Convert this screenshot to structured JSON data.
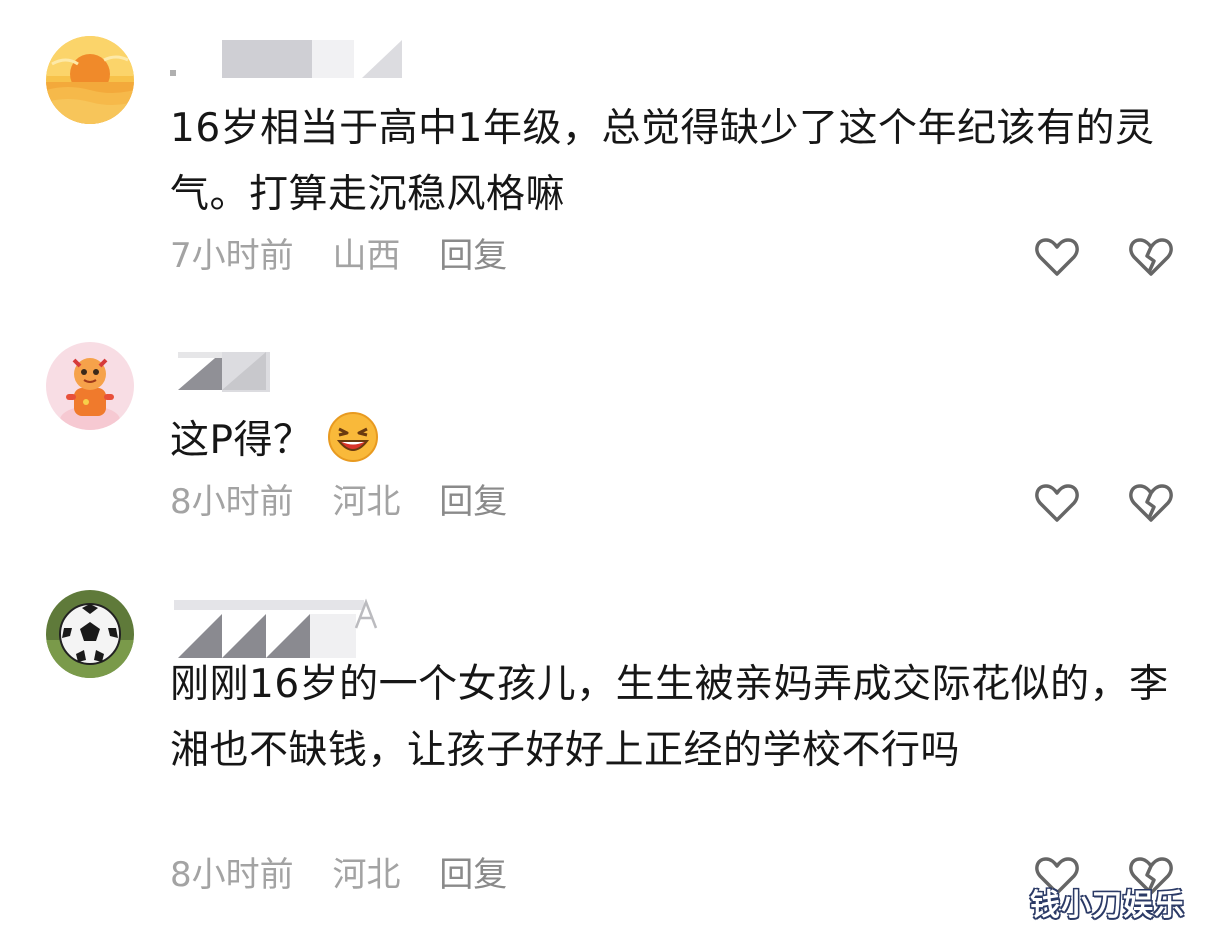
{
  "comments": [
    {
      "text": "16岁相当于高中1年级，总觉得缺少了这个年纪该有的灵气。打算走沉稳风格嘛",
      "time": "7小时前",
      "location": "山西",
      "reply_label": "回复",
      "avatar_icon": "sunset-avatar-icon"
    },
    {
      "text": "这P得？",
      "emoji_icon": "laughing-emoji-icon",
      "time": "8小时前",
      "location": "河北",
      "reply_label": "回复",
      "avatar_icon": "cartoon-character-avatar-icon"
    },
    {
      "text": "刚刚16岁的一个女孩儿，生生被亲妈弄成交际花似的，李湘也不缺钱，让孩子好好上正经的学校不行吗",
      "time": "8小时前",
      "location": "河北",
      "reply_label": "回复",
      "avatar_icon": "soccer-ball-avatar-icon"
    }
  ],
  "watermark": "钱小刀娱乐",
  "colors": {
    "text": "#161616",
    "meta": "#a3a3a3",
    "icon_stroke": "#666666"
  }
}
